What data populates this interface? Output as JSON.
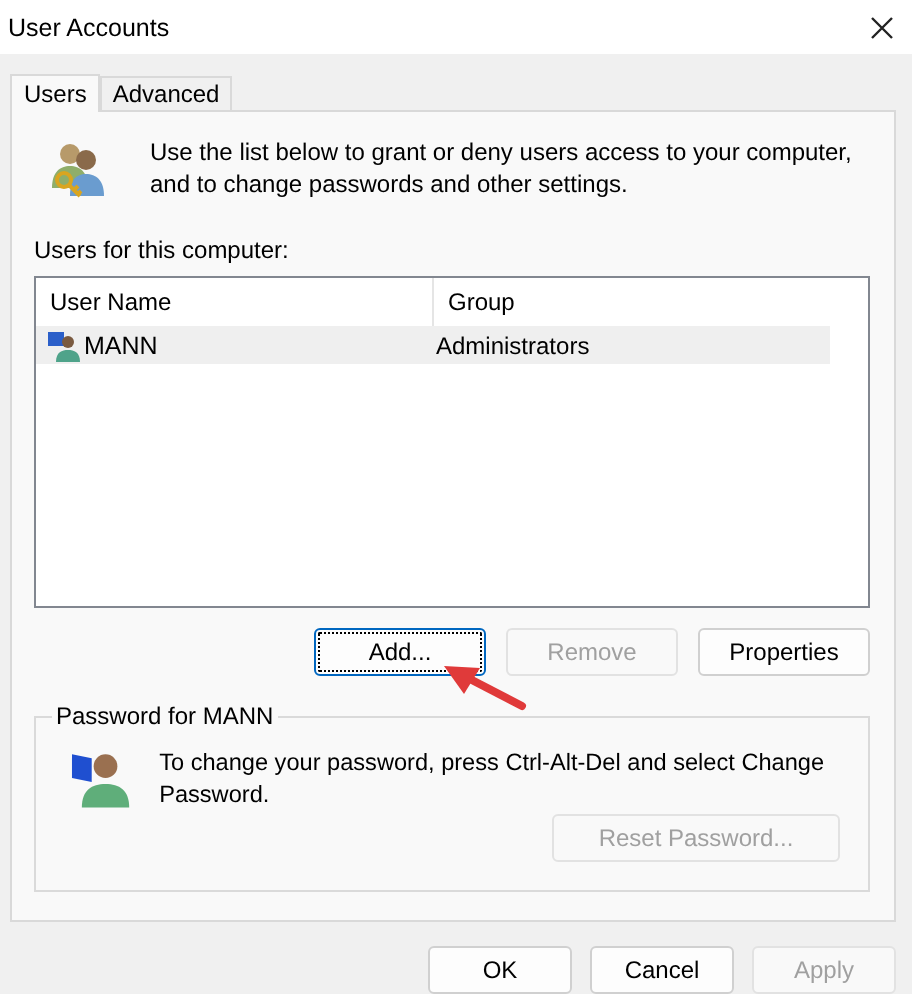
{
  "window": {
    "title": "User Accounts"
  },
  "tabs": [
    {
      "label": "Users",
      "selected": true
    },
    {
      "label": "Advanced",
      "selected": false
    }
  ],
  "intro": "Use the list below to grant or deny users access to your computer, and to change passwords and other settings.",
  "list_label": "Users for this computer:",
  "table": {
    "columns": [
      "User Name",
      "Group"
    ],
    "rows": [
      {
        "name": "MANN",
        "group": "Administrators",
        "selected": true
      }
    ]
  },
  "list_buttons": [
    {
      "label": "Add...",
      "disabled": false,
      "focused": true
    },
    {
      "label": "Remove",
      "disabled": true,
      "focused": false
    },
    {
      "label": "Properties",
      "disabled": false,
      "focused": false
    }
  ],
  "password_group": {
    "title": "Password for MANN",
    "text": "To change your password, press Ctrl-Alt-Del and select Change Password.",
    "button": {
      "label": "Reset Password...",
      "disabled": true
    }
  },
  "dialog_buttons": [
    {
      "label": "OK",
      "disabled": false
    },
    {
      "label": "Cancel",
      "disabled": false
    },
    {
      "label": "Apply",
      "disabled": true
    }
  ]
}
